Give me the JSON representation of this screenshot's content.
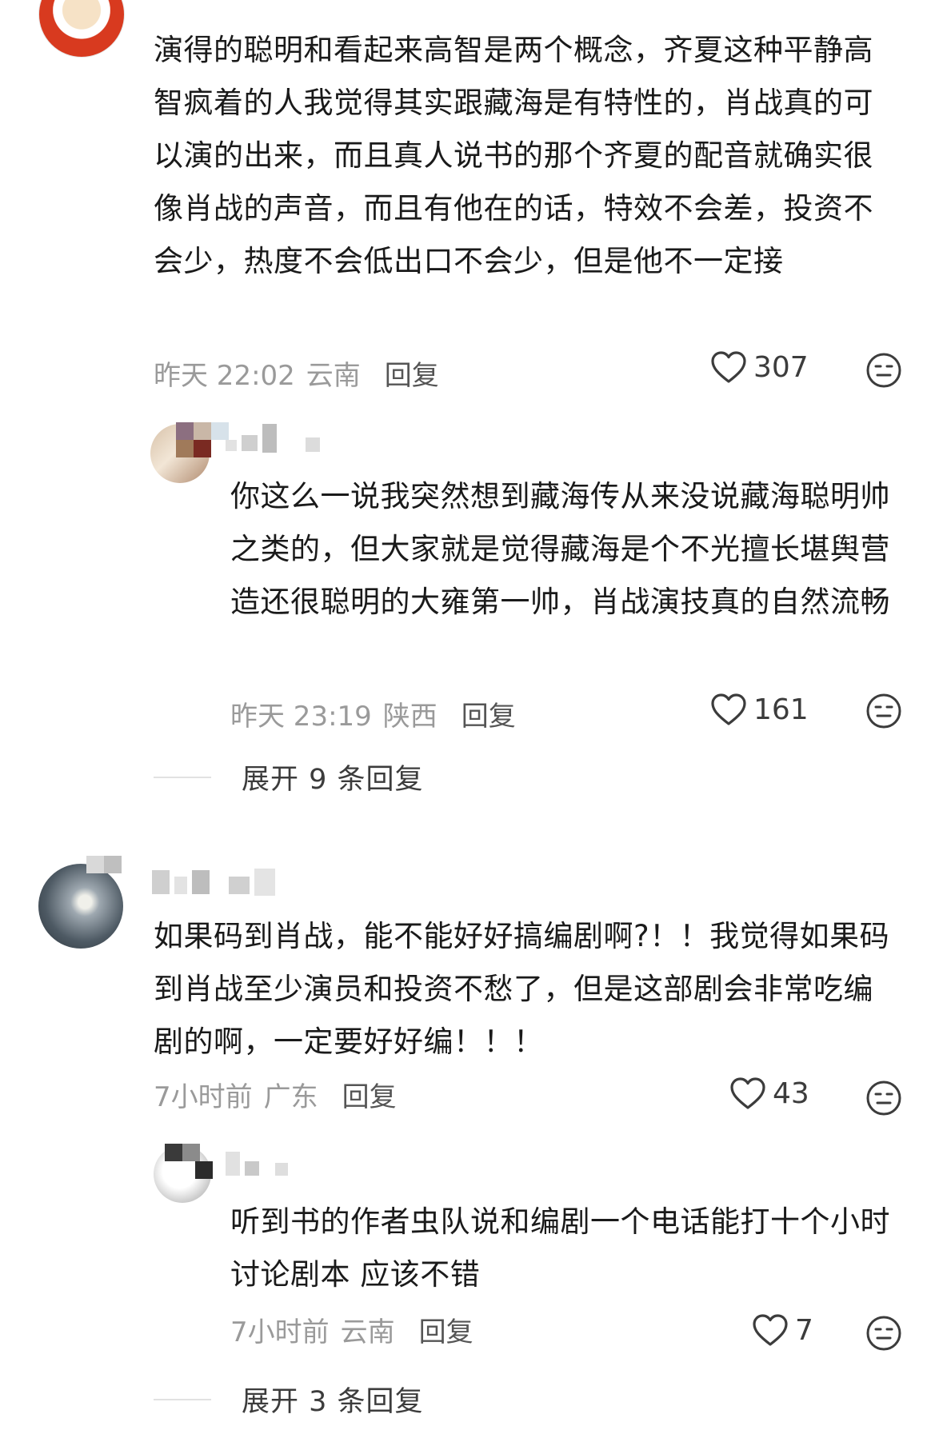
{
  "comments": [
    {
      "text": "演得的聪明和看起来高智是两个概念，齐夏这种平静高智疯着的人我觉得其实跟藏海是有特性的，肖战真的可以演的出来，而且真人说书的那个齐夏的配音就确实很像肖战的声音，而且有他在的话，特效不会差，投资不会少，热度不会低出口不会少，但是他不一定接",
      "time": "昨天 22:02",
      "location": "云南",
      "reply_label": "回复",
      "likes": "307",
      "reply": {
        "text": "你这么一说我突然想到藏海传从来没说藏海聪明帅之类的，但大家就是觉得藏海是个不光擅长堪舆营造还很聪明的大雍第一帅，肖战演技真的自然流畅",
        "time": "昨天 23:19",
        "location": "陕西",
        "reply_label": "回复",
        "likes": "161"
      },
      "expand_label": "展开 9 条回复"
    },
    {
      "text": "如果码到肖战，能不能好好搞编剧啊?！！我觉得如果码到肖战至少演员和投资不愁了，但是这部剧会非常吃编剧的啊，一定要好好编！！！",
      "time": "7小时前",
      "location": "广东",
      "reply_label": "回复",
      "likes": "43",
      "reply": {
        "text": "听到书的作者虫队说和编剧一个电话能打十个小时讨论剧本 应该不错",
        "time": "7小时前",
        "location": "云南",
        "reply_label": "回复",
        "likes": "7"
      },
      "expand_label": "展开 3 条回复"
    }
  ],
  "icons": {
    "like": "heart-outline-icon",
    "reaction": "neutral-face-icon"
  },
  "colors": {
    "meta_gray": "#9a9a9a",
    "text": "#1a1a1a"
  }
}
